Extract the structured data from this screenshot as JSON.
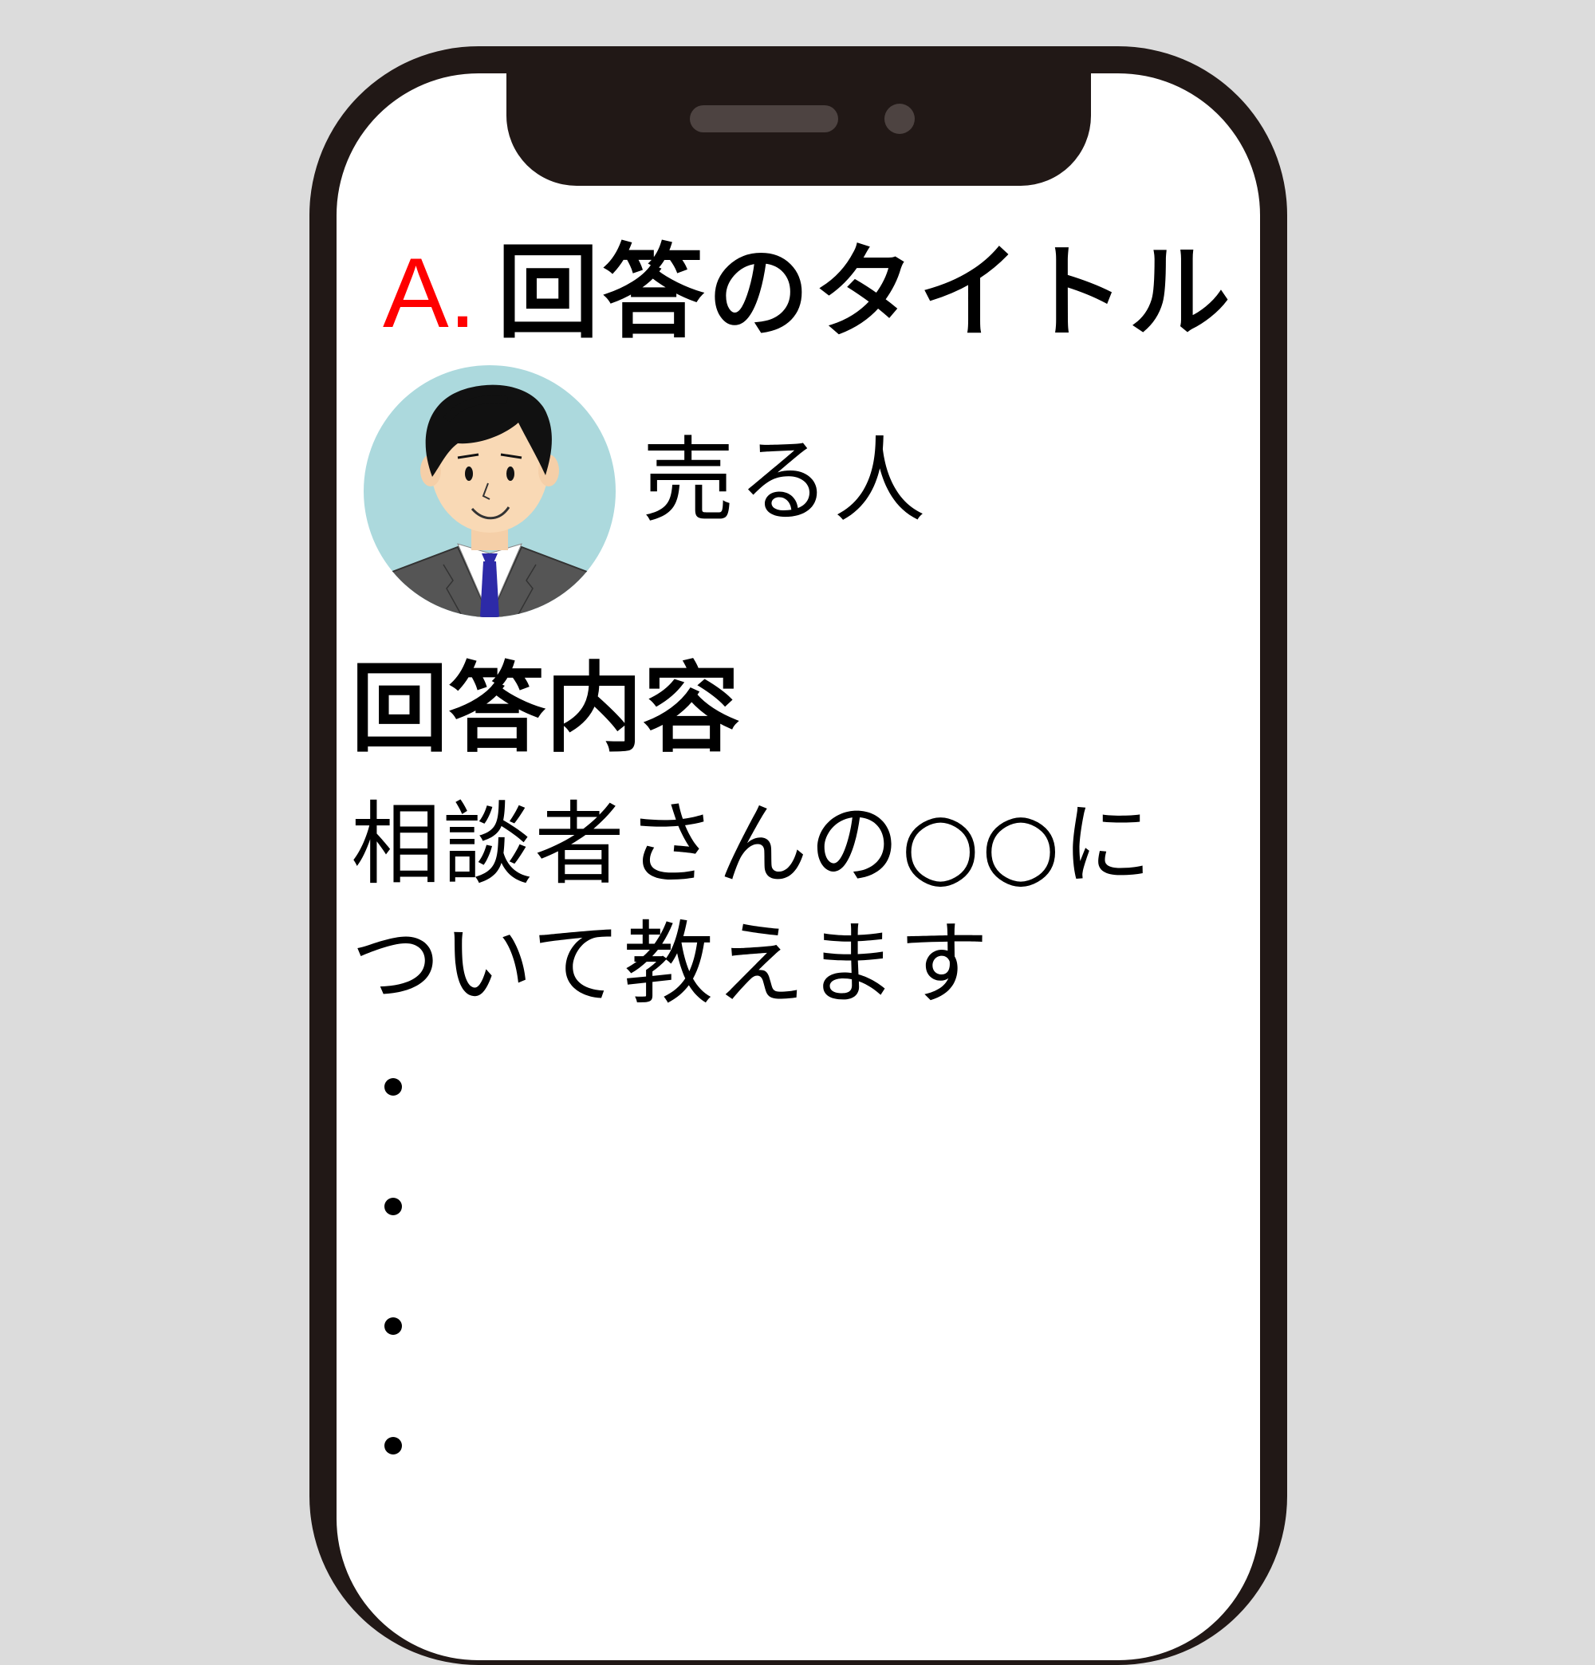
{
  "answer": {
    "prefix": "A.",
    "title": "回答のタイトル"
  },
  "author": {
    "name": "売る人",
    "avatar_icon": "businessman-avatar-icon"
  },
  "content": {
    "heading": "回答内容",
    "body": "相談者さんの○○について教えます",
    "bullets": [
      "•",
      "•",
      "•",
      "•"
    ]
  },
  "colors": {
    "accent": "#ff0000",
    "phone_frame": "#211816",
    "avatar_background": "#acd9dd",
    "page_background": "#dcdcdc"
  }
}
